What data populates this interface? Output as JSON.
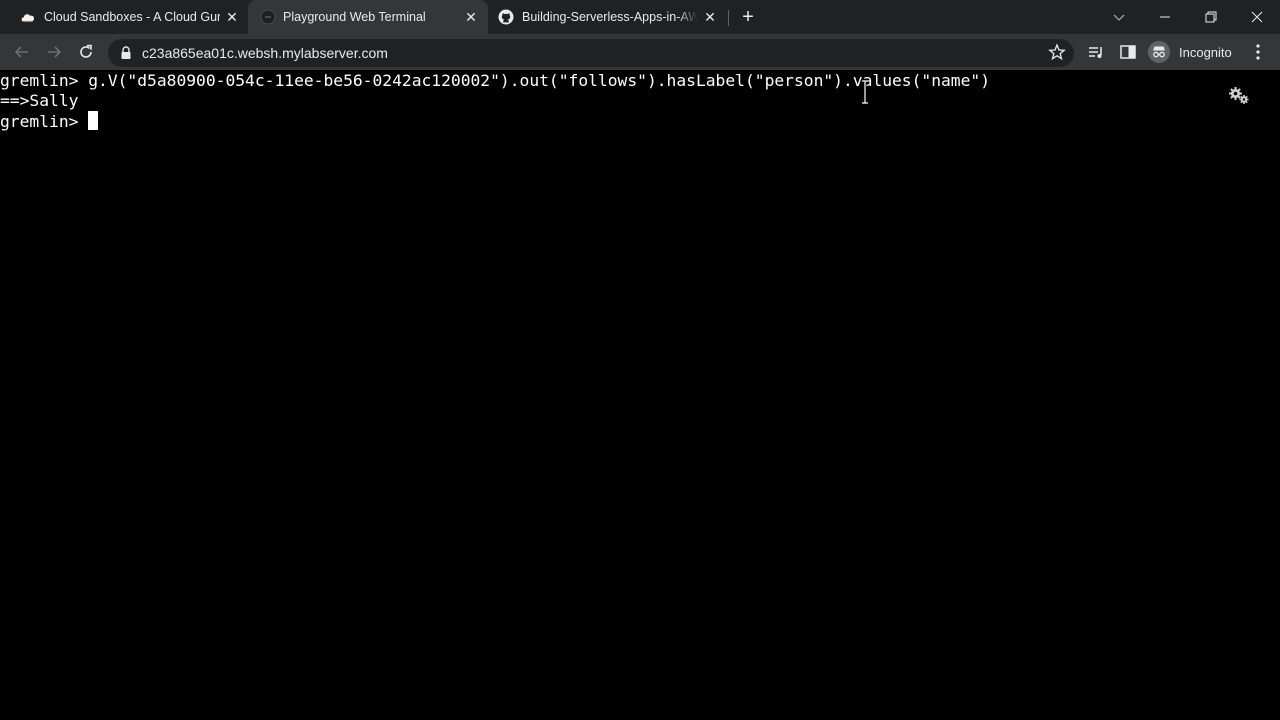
{
  "tabs": [
    {
      "title": "Cloud Sandboxes - A Cloud Guru",
      "icon": "cloud-guru-icon",
      "active": false
    },
    {
      "title": "Playground Web Terminal",
      "icon": "terminal-favicon",
      "active": true
    },
    {
      "title": "Building-Serverless-Apps-in-AWS",
      "icon": "github-icon",
      "active": false
    }
  ],
  "address_bar": {
    "url": "c23a865ea01c.websh.mylabserver.com"
  },
  "profile": {
    "label": "Incognito"
  },
  "terminal": {
    "lines": [
      "gremlin> g.V(\"d5a80900-054c-11ee-be56-0242ac120002\").out(\"follows\").hasLabel(\"person\").values(\"name\")",
      "==>Sally",
      "gremlin> "
    ]
  },
  "colors": {
    "tabstrip_bg": "#202124",
    "toolbar_bg": "#35363a",
    "terminal_bg": "#000000",
    "terminal_fg": "#ffffff"
  }
}
